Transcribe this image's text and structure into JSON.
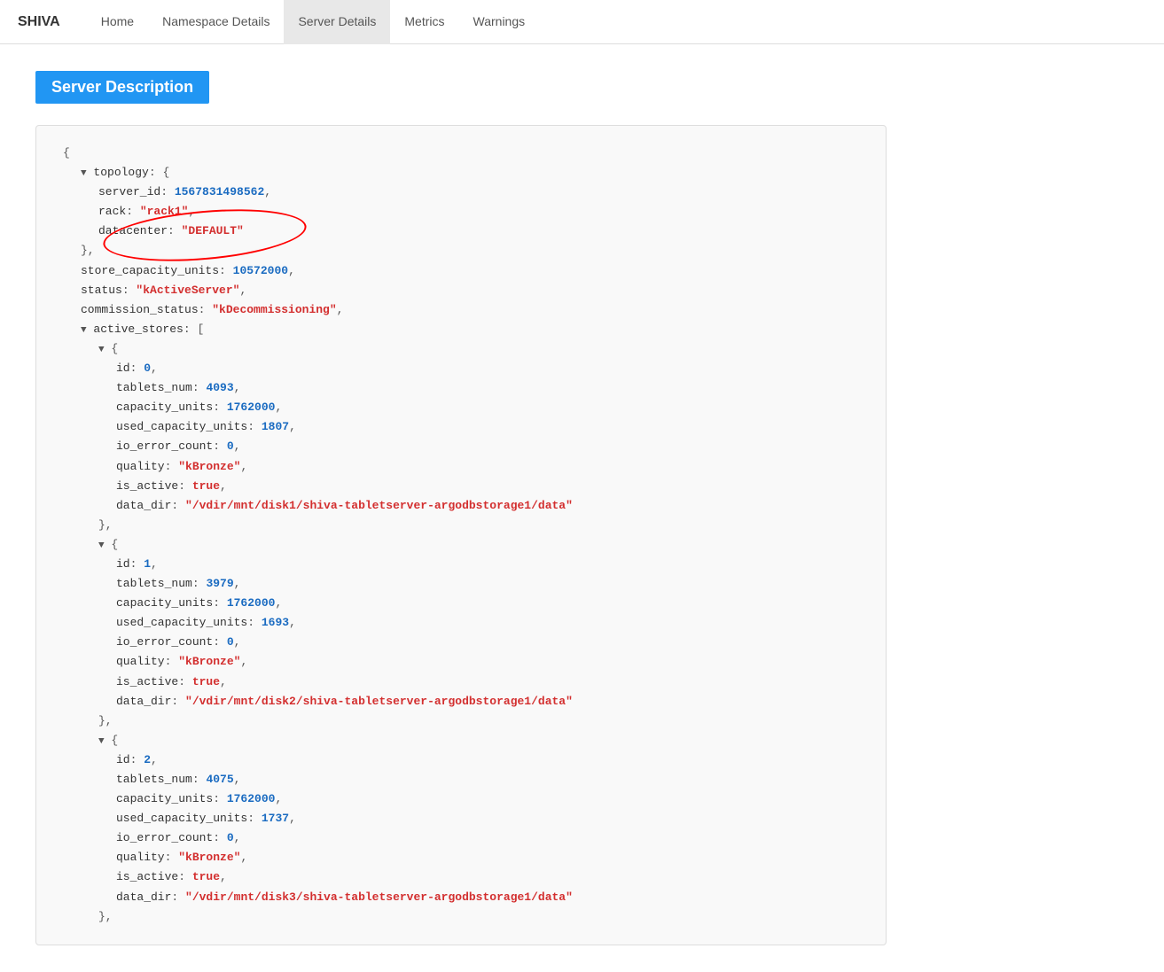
{
  "navbar": {
    "brand": "SHIVA",
    "items": [
      {
        "label": "Home",
        "active": false
      },
      {
        "label": "Namespace Details",
        "active": false
      },
      {
        "label": "Server Details",
        "active": true
      },
      {
        "label": "Metrics",
        "active": false
      },
      {
        "label": "Warnings",
        "active": false
      }
    ]
  },
  "section": {
    "title": "Server Description"
  },
  "json_content": {
    "lines": [
      "{ ",
      "  topology: {",
      "    server_id: 1567831498562,",
      "    rack: \"rack1\",",
      "    datacenter: \"DEFAULT\"",
      "  },",
      "  store_capacity_units: 10572000,",
      "  status: \"kActiveServer\",",
      "  commission_status: \"kDecommissioning\",",
      "  active_stores: [",
      "    ▼ {",
      "        id: 0,",
      "        tablets_num: 4093,",
      "        capacity_units: 1762000,",
      "        used_capacity_units: 1807,",
      "        io_error_count: 0,",
      "        quality: \"kBronze\",",
      "        is_active: true,",
      "        data_dir: \"/vdir/mnt/disk1/shiva-tabletserver-argodbstorage1/data\"",
      "      },",
      "    ▼ {",
      "        id: 1,",
      "        tablets_num: 3979,",
      "        capacity_units: 1762000,",
      "        used_capacity_units: 1693,",
      "        io_error_count: 0,",
      "        quality: \"kBronze\",",
      "        is_active: true,",
      "        data_dir: \"/vdir/mnt/disk2/shiva-tabletserver-argodbstorage1/data\"",
      "      },",
      "    ▼ {",
      "        id: 2,",
      "        tablets_num: 4075,",
      "        capacity_units: 1762000,",
      "        used_capacity_units: 1737,",
      "        io_error_count: 0,",
      "        quality: \"kBronze\",",
      "        is_active: true,",
      "        data_dir: \"/vdir/mnt/disk3/shiva-tabletserver-argodbstorage1/data\"",
      "      },"
    ]
  }
}
